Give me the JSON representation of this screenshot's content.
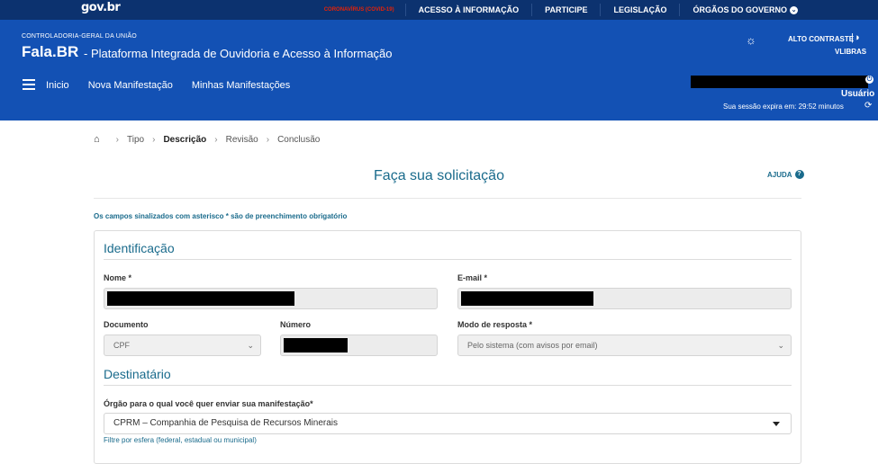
{
  "topbar": {
    "logo": "gov.br",
    "nav": [
      "CORONAVÍRUS (COVID-19)",
      "ACESSO À INFORMAÇÃO",
      "PARTICIPE",
      "LEGISLAÇÃO",
      "ÓRGÃOS DO GOVERNO"
    ],
    "chevron_icon": "chevron-down-icon"
  },
  "header": {
    "org": "CONTROLADORIA-GERAL DA UNIÃO",
    "brand": "Fala.BR",
    "subtitle": "- Plataforma Integrada de Ouvidoria e Acesso à Informação",
    "contrast_label": "ALTO CONTRASTE",
    "vlibras": "VLIBRAS",
    "nav": [
      "Inicio",
      "Nova Manifestação",
      "Minhas Manifestações"
    ],
    "user_label": "Usuário",
    "session": "Sua sessão expira em: 29:52 minutos",
    "colors": {
      "topbar": "#0c326f",
      "header": "#1351b4",
      "covid": "#e52207"
    }
  },
  "breadcrumb": [
    "Tipo",
    "Descrição",
    "Revisão",
    "Conclusão"
  ],
  "page": {
    "title": "Faça sua solicitação",
    "help": "AJUDA",
    "required_note": "Os campos sinalizados com asterisco * são de preenchimento obrigatório",
    "accent": "#1a6b8c"
  },
  "form": {
    "identificacao": {
      "title": "Identificação",
      "nome_label": "Nome *",
      "email_label": "E-mail *",
      "documento_label": "Documento",
      "documento_value": "CPF",
      "numero_label": "Número",
      "modo_label": "Modo de resposta *",
      "modo_value": "Pelo sistema (com avisos por email)"
    },
    "destinatario": {
      "title": "Destinatário",
      "orgao_label": "Órgão para o qual você quer enviar sua manifestação*",
      "orgao_value": "CPRM – Companhia de Pesquisa de Recursos Minerais",
      "filter_link": "Filtre por esfera (federal, estadual ou municipal)"
    }
  }
}
